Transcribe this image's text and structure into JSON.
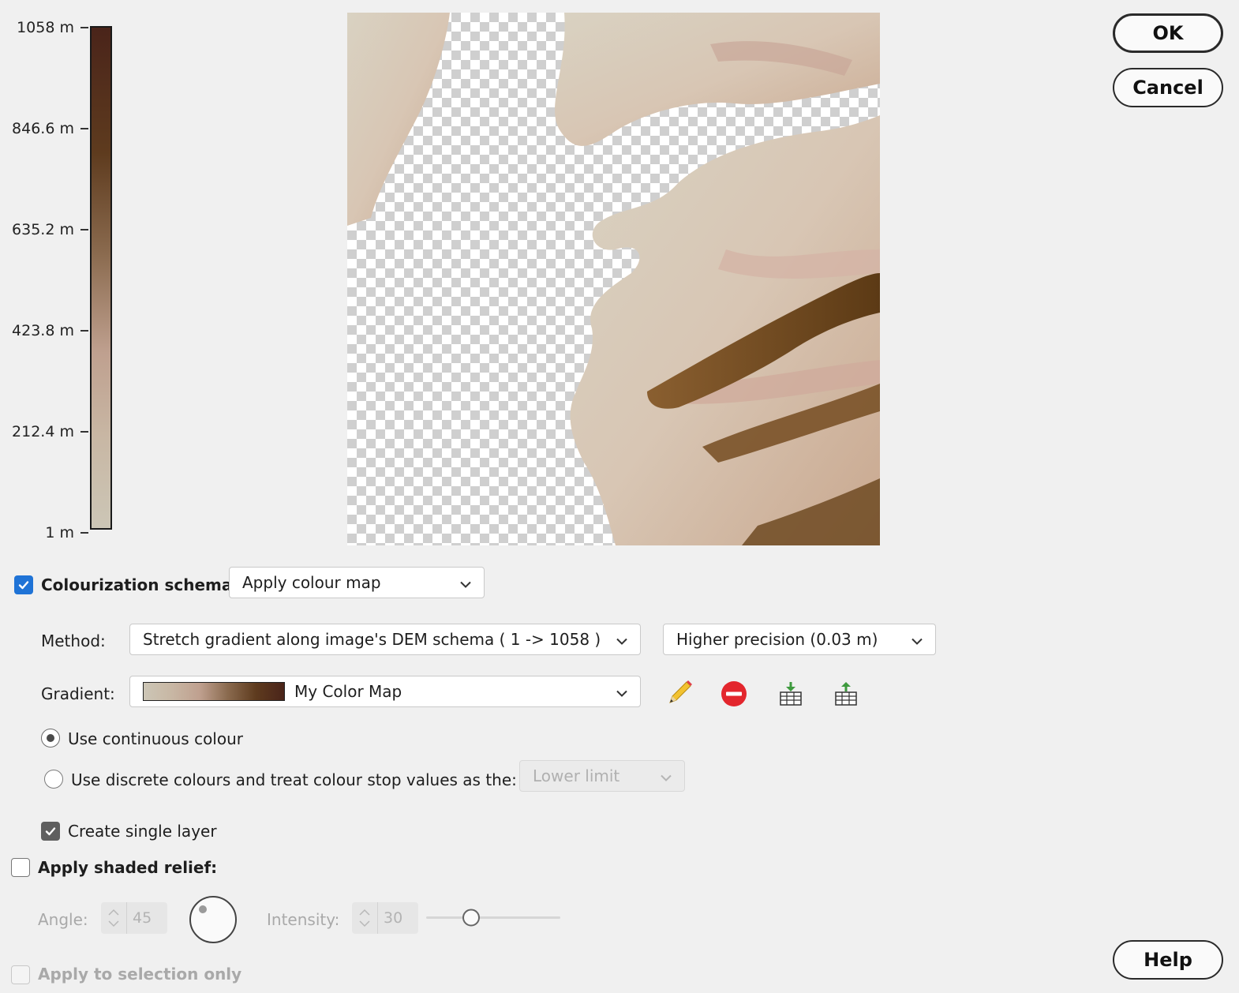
{
  "legend": {
    "ticks": [
      "1058 m",
      "846.6 m",
      "635.2 m",
      "423.8 m",
      "212.4 m",
      "1 m"
    ],
    "gradient_colors": [
      "#4a241a",
      "#5e3b1e",
      "#8a6a4e",
      "#bfa08f",
      "#c8b7a4",
      "#ccc6b6"
    ]
  },
  "buttons": {
    "ok": "OK",
    "cancel": "Cancel",
    "help": "Help"
  },
  "colourization": {
    "checked": true,
    "label": "Colourization schema:",
    "schema_value": "Apply colour map"
  },
  "method": {
    "label": "Method:",
    "value": "Stretch gradient along image's DEM schema ( 1 -> 1058 )",
    "precision_value": "Higher precision (0.03 m)"
  },
  "gradient": {
    "label": "Gradient:",
    "value": "My Color Map",
    "edit_icon": "pencil-icon",
    "remove_icon": "remove-icon",
    "import_icon": "import-table-icon",
    "export_icon": "export-table-icon"
  },
  "colour_mode": {
    "continuous_label": "Use continuous colour",
    "discrete_label": "Use discrete colours and treat colour stop values as the:",
    "discrete_option": "Lower limit",
    "selected": "continuous"
  },
  "single_layer": {
    "label": "Create single layer",
    "checked": true
  },
  "shaded_relief": {
    "label": "Apply shaded relief:",
    "checked": false,
    "angle_label": "Angle:",
    "angle_value": "45",
    "intensity_label": "Intensity:",
    "intensity_value": "30"
  },
  "selection_only": {
    "label": "Apply to selection only",
    "checked": false
  }
}
